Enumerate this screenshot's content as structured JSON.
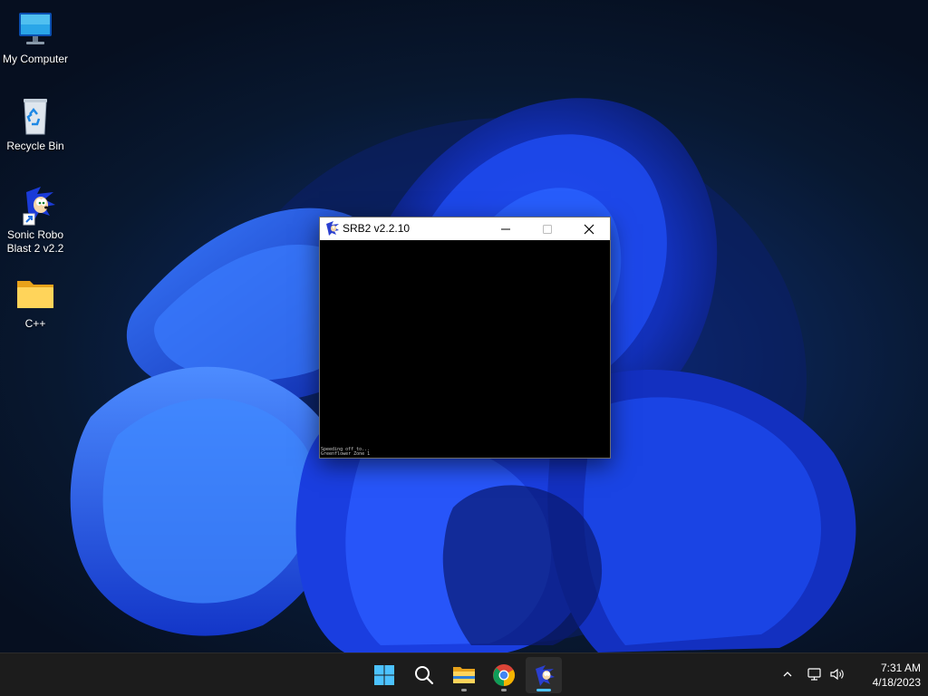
{
  "desktop": {
    "icons": [
      {
        "label": "My Computer",
        "icon": "monitor-icon"
      },
      {
        "label": "Recycle Bin",
        "icon": "recycle-bin-icon"
      },
      {
        "label": "Sonic Robo\nBlast 2 v2.2",
        "icon": "sonic-shortcut-icon"
      },
      {
        "label": "C++",
        "icon": "folder-icon"
      }
    ]
  },
  "window": {
    "title": "SRB2 v2.2.10",
    "icon": "sonic-icon",
    "console_lines": [
      "Speeding off to...",
      "Greenflower Zone 1"
    ]
  },
  "taskbar": {
    "items": [
      {
        "name": "start",
        "icon": "windows-logo-icon"
      },
      {
        "name": "search",
        "icon": "search-icon"
      },
      {
        "name": "file-explorer",
        "icon": "folder-icon"
      },
      {
        "name": "chrome",
        "icon": "chrome-icon"
      },
      {
        "name": "srb2",
        "icon": "sonic-icon"
      }
    ],
    "tray": {
      "chevron_icon": "chevron-up-icon",
      "network_icon": "network-icon",
      "volume_icon": "volume-icon"
    },
    "time": "7:31 AM",
    "date": "4/18/2023"
  },
  "colors": {
    "accent": "#0078d4",
    "taskbar_bg": "#1c1c1c",
    "window_bg": "#000000",
    "titlebar_bg": "#ffffff"
  }
}
